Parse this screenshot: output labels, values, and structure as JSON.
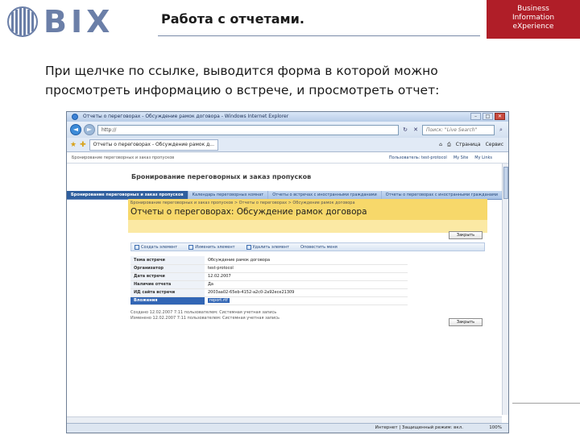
{
  "slide": {
    "logo_text": "BIX",
    "title": "Работа с отчетами.",
    "brand_lines": [
      "Business",
      "Information",
      "eXperience"
    ],
    "intro_lines": [
      "При щелчке по ссылке, выводится форма в которой можно",
      "просмотреть информацию о встрече, и просмотреть отчет:"
    ]
  },
  "browser": {
    "window_title": "Отчеты о переговорах - Обсуждение рамок договора - Windows Internet Explorer",
    "address": "http://",
    "search_placeholder": "Поиск: \"Live Search\"",
    "tab_title": "Отчеты о переговорах - Обсуждение рамок д...",
    "tools": [
      "Страница",
      "Сервис"
    ],
    "status_zone": "Интернет | Защищенный режим: вкл.",
    "zoom": "100%",
    "colors": {
      "accent": "#2f5f9f",
      "yellow": "#f7d86a",
      "brand_red": "#b01e28"
    }
  },
  "sharepoint": {
    "top_left": "Бронирование переговорных и заказ пропусков",
    "user": "Пользователь: test-protocol",
    "my_site": "My Site",
    "my_links": "My Links",
    "site_title": "Бронирование переговорных и заказ пропусков",
    "nav": [
      "Бронирование переговорных и заказ пропусков",
      "Календарь переговорных комнат",
      "Отчеты о встречах с иностранными гражданами",
      "Отчеты о переговорах с иностранными гражданами"
    ],
    "breadcrumb": "Бронирование переговорных и заказ пропусков > Отчеты о переговорах > Обсуждение рамок договора",
    "page_title": "Отчеты о переговорах: Обсуждение рамок договора",
    "close_label": "Закрыть",
    "toolbar": [
      "Создать элемент",
      "Изменить элемент",
      "Удалить элемент",
      "Оповестить меня"
    ],
    "fields": [
      {
        "label": "Тема встречи",
        "value": "Обсуждение рамок договора"
      },
      {
        "label": "Организатор",
        "value": "test-protocol"
      },
      {
        "label": "Дата встречи",
        "value": "12.02.2007"
      },
      {
        "label": "Наличие отчета",
        "value": "Да"
      },
      {
        "label": "ИД сайта встречи",
        "value": "2003aa02-65eb-4152-a2c0-2a92ece21309"
      },
      {
        "label": "Вложения",
        "value": "report.rtf"
      }
    ],
    "footer_lines": [
      "Создано 12.02.2007 7:11 пользователем: Системная учетная запись",
      "Изменено 12.02.2007 7:11 пользователем: Системная учетная запись"
    ]
  }
}
